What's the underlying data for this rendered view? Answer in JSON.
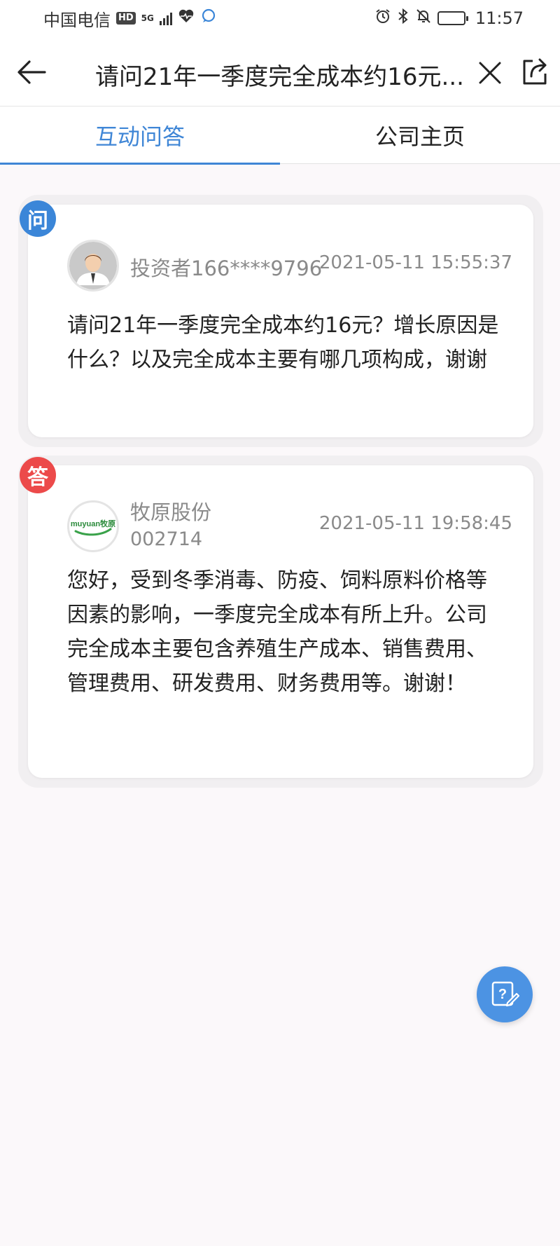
{
  "status_bar": {
    "carrier": "中国电信",
    "hd_badge": "HD",
    "network": "5G",
    "time": "11:57"
  },
  "header": {
    "title": "请问21年一季度完全成本约16元..."
  },
  "tabs": [
    {
      "label": "互动问答",
      "active": true
    },
    {
      "label": "公司主页",
      "active": false
    }
  ],
  "question": {
    "badge": "问",
    "user": "投资者166****9796",
    "time": "2021-05-11 15:55:37",
    "text": "请问21年一季度完全成本约16元？增长原因是什么？以及完全成本主要有哪几项构成，谢谢"
  },
  "answer": {
    "badge": "答",
    "company": "牧原股份",
    "code": "002714",
    "logo_text": "muyuan牧原",
    "time": "2021-05-11 19:58:45",
    "text": "您好，受到冬季消毒、防疫、饲料原料价格等因素的影响，一季度完全成本有所上升。公司完全成本主要包含养殖生产成本、销售费用、管理费用、研发费用、财务费用等。谢谢！"
  },
  "colors": {
    "accent": "#3f86d6",
    "question_badge": "#3b86d8",
    "answer_badge": "#ec4a4a",
    "fab": "#4c93e3"
  }
}
